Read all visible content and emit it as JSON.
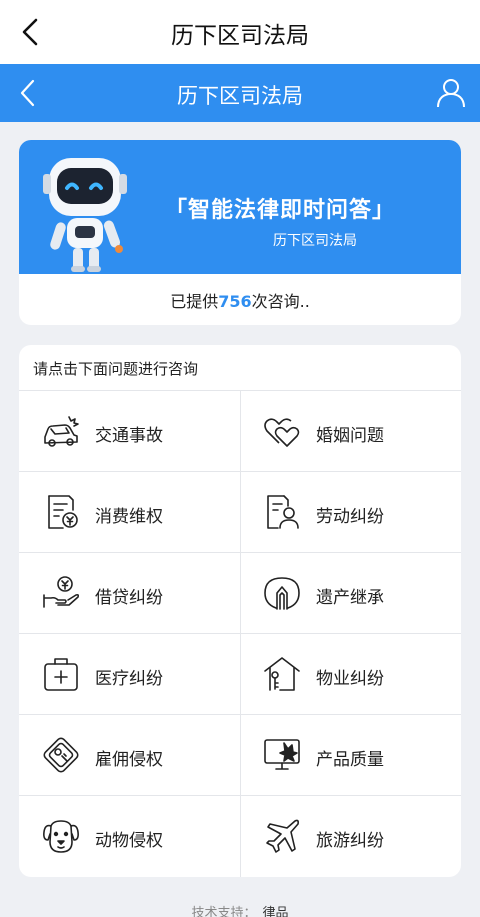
{
  "header": {
    "title": "历下区司法局"
  },
  "subheader": {
    "title": "历下区司法局"
  },
  "banner": {
    "headline": "「智能法律即时问答」",
    "subtitle": "历下区司法局",
    "served_prefix": "已提供",
    "served_count": "756",
    "served_suffix": "次咨询.."
  },
  "consult": {
    "prompt": "请点击下面问题进行咨询",
    "items": [
      {
        "label": "交通事故",
        "icon": "car-accident-icon"
      },
      {
        "label": "婚姻问题",
        "icon": "hearts-icon"
      },
      {
        "label": "消费维权",
        "icon": "receipt-icon"
      },
      {
        "label": "劳动纠纷",
        "icon": "worker-document-icon"
      },
      {
        "label": "借贷纠纷",
        "icon": "hand-coin-icon"
      },
      {
        "label": "遗产继承",
        "icon": "inheritance-icon"
      },
      {
        "label": "医疗纠纷",
        "icon": "medical-kit-icon"
      },
      {
        "label": "物业纠纷",
        "icon": "house-key-icon"
      },
      {
        "label": "雇佣侵权",
        "icon": "employment-card-icon"
      },
      {
        "label": "产品质量",
        "icon": "broken-monitor-icon"
      },
      {
        "label": "动物侵权",
        "icon": "dog-icon"
      },
      {
        "label": "旅游纠纷",
        "icon": "airplane-icon"
      }
    ]
  },
  "footer": {
    "label": "技术支持：",
    "value": "律品"
  },
  "colors": {
    "brand_blue": "#2f8ef0",
    "background": "#eef0f4"
  }
}
